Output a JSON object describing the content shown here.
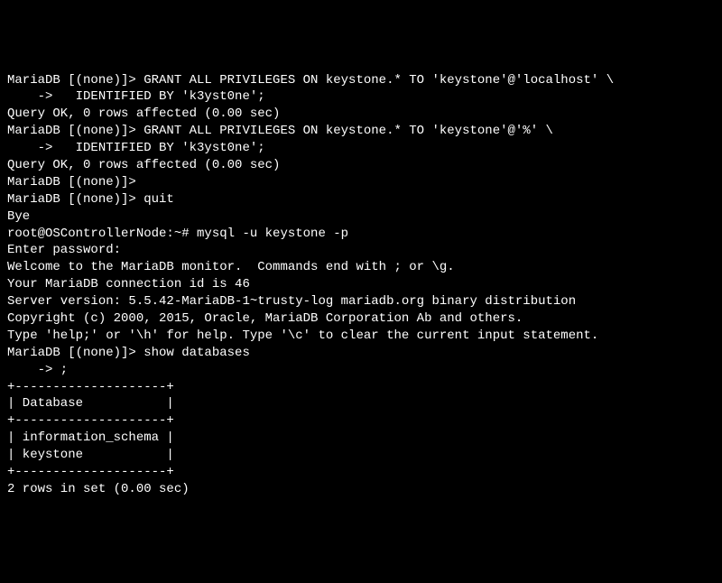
{
  "lines": [
    "MariaDB [(none)]> GRANT ALL PRIVILEGES ON keystone.* TO 'keystone'@'localhost' \\",
    "    ->   IDENTIFIED BY 'k3yst0ne';",
    "Query OK, 0 rows affected (0.00 sec)",
    "",
    "MariaDB [(none)]> GRANT ALL PRIVILEGES ON keystone.* TO 'keystone'@'%' \\",
    "    ->   IDENTIFIED BY 'k3yst0ne';",
    "Query OK, 0 rows affected (0.00 sec)",
    "",
    "MariaDB [(none)]>",
    "MariaDB [(none)]> quit",
    "Bye",
    "root@OSControllerNode:~# mysql -u keystone -p",
    "Enter password:",
    "Welcome to the MariaDB monitor.  Commands end with ; or \\g.",
    "Your MariaDB connection id is 46",
    "Server version: 5.5.42-MariaDB-1~trusty-log mariadb.org binary distribution",
    "",
    "Copyright (c) 2000, 2015, Oracle, MariaDB Corporation Ab and others.",
    "",
    "Type 'help;' or '\\h' for help. Type '\\c' to clear the current input statement.",
    "",
    "MariaDB [(none)]> show databases",
    "    -> ;",
    "+--------------------+",
    "| Database           |",
    "+--------------------+",
    "| information_schema |",
    "| keystone           |",
    "+--------------------+",
    "2 rows in set (0.00 sec)"
  ]
}
